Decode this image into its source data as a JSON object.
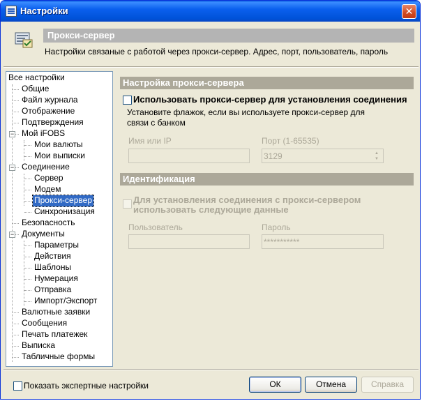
{
  "window": {
    "title": "Настройки"
  },
  "header": {
    "title": "Прокси-сервер",
    "description": "Настройки связаные с работой через прокси-сервер. Адрес, порт, пользователь, пароль"
  },
  "tree": {
    "root": "Все настройки",
    "items": [
      "Общие",
      "Файл журнала",
      "Отображение",
      "Подтверждения",
      "Мой iFOBS",
      "Мои валюты",
      "Мои выписки",
      "Соединение",
      "Сервер",
      "Модем",
      "Прокси-сервер",
      "Синхронизация",
      "Безопасность",
      "Документы",
      "Параметры",
      "Действия",
      "Шаблоны",
      "Нумерация",
      "Отправка",
      "Импорт/Экспорт",
      "Валютные заявки",
      "Сообщения",
      "Печать платежек",
      "Выписка",
      "Табличные формы"
    ]
  },
  "proxy_section": {
    "title": "Настройка прокси-сервера",
    "use_proxy_label": "Использовать прокси-сервер для установления соединения",
    "hint_line1": "Установите флажок, если вы используете прокси-сервер для",
    "hint_line2": "связи с банком",
    "host_label": "Имя или IP",
    "host_value": "",
    "port_label": "Порт (1-65535)",
    "port_value": "3129"
  },
  "ident_section": {
    "title": "Идентификация",
    "use_creds_line1": "Для установления соединения с прокси-сервером",
    "use_creds_line2": "использовать следующие данные",
    "user_label": "Пользователь",
    "user_value": "",
    "password_label": "Пароль",
    "password_value": "***********"
  },
  "footer": {
    "expert_label": "Показать экспертные настройки",
    "ok": "ОК",
    "cancel": "Отмена",
    "apply": "Справка"
  }
}
